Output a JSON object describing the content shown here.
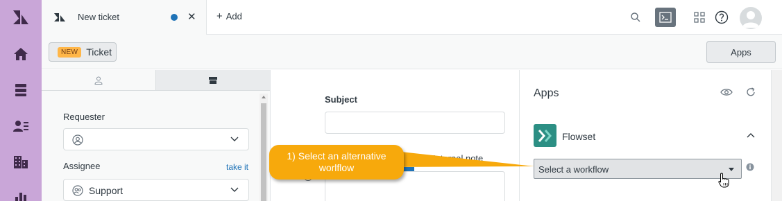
{
  "top_tab": {
    "title": "New ticket",
    "add_label": "Add"
  },
  "subbar": {
    "new_badge": "NEW",
    "ticket_label": "Ticket",
    "apps_button": "Apps"
  },
  "properties": {
    "requester_label": "Requester",
    "assignee_label": "Assignee",
    "take_it": "take it",
    "assignee_value": "Support"
  },
  "center": {
    "subject_label": "Subject",
    "internal_note": "Internal note"
  },
  "apps_panel": {
    "title": "Apps",
    "app_name": "Flowset",
    "workflow_select": "Select a workflow"
  },
  "callout": {
    "text": "1) Select an alternative worlflow"
  },
  "colors": {
    "rail": "#c9a6d8",
    "callout": "#f7a90c",
    "flowset": "#2c8f84",
    "unsaved_dot": "#1f73b7"
  }
}
